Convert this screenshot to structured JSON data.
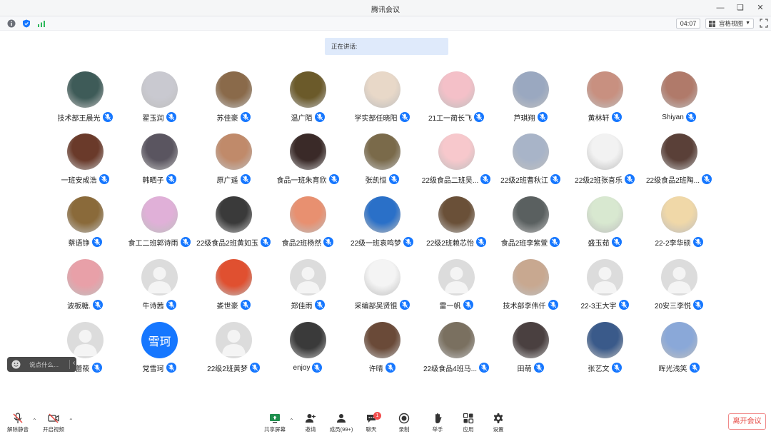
{
  "window": {
    "title": "腾讯会议"
  },
  "topbar": {
    "timer": "04:07",
    "view_label": "宫格视图"
  },
  "speaking": {
    "label": "正在讲话:"
  },
  "participants": [
    {
      "name": "技术部王晨光",
      "avatar": "photo",
      "color": "#3e5b58"
    },
    {
      "name": "翟玉润",
      "avatar": "photo",
      "color": "#c9c9d0"
    },
    {
      "name": "苏佳豪",
      "avatar": "photo",
      "color": "#8a6a4a"
    },
    {
      "name": "温广陌",
      "avatar": "photo",
      "color": "#6b5a2a"
    },
    {
      "name": "学实部任晓阳",
      "avatar": "photo",
      "color": "#e8d8c8"
    },
    {
      "name": "21工一蔺长飞",
      "avatar": "photo",
      "color": "#f4c0c8"
    },
    {
      "name": "芦琪翔",
      "avatar": "photo",
      "color": "#9aa8c0"
    },
    {
      "name": "黄林轩",
      "avatar": "photo",
      "color": "#c89080"
    },
    {
      "name": "Shiyan",
      "avatar": "photo",
      "color": "#b07a6a"
    },
    {
      "name": "一班安成浩",
      "avatar": "photo",
      "color": "#6a3a2a"
    },
    {
      "name": "韩晒子",
      "avatar": "photo",
      "color": "#5a5560"
    },
    {
      "name": "原广遥",
      "avatar": "photo",
      "color": "#c08a6a"
    },
    {
      "name": "食品一班朱育欣",
      "avatar": "photo",
      "color": "#3a2a28"
    },
    {
      "name": "张凯恒",
      "avatar": "photo",
      "color": "#7a6a4a"
    },
    {
      "name": "22级食品二班吴...",
      "avatar": "photo",
      "color": "#f7c8cc"
    },
    {
      "name": "22级2班曹秋江",
      "avatar": "photo",
      "color": "#a8b4c8"
    },
    {
      "name": "22级2班张喜乐",
      "avatar": "photo",
      "color": "#f2f2f2"
    },
    {
      "name": "22级食品2班陶...",
      "avatar": "photo",
      "color": "#5a4038"
    },
    {
      "name": "蔡语铮",
      "avatar": "photo",
      "color": "#8a6a3a"
    },
    {
      "name": "食工二班郭诗雨",
      "avatar": "photo",
      "color": "#e0b0d8"
    },
    {
      "name": "22级食品2班黄如玉",
      "avatar": "photo",
      "color": "#3a3a3a"
    },
    {
      "name": "食品2班杨然",
      "avatar": "photo",
      "color": "#e89070"
    },
    {
      "name": "22级一班袁鸣梦",
      "avatar": "photo",
      "color": "#2a70c8"
    },
    {
      "name": "22级2班赖芯怡",
      "avatar": "photo",
      "color": "#6a5038"
    },
    {
      "name": "食品2班李紫萱",
      "avatar": "photo",
      "color": "#5a6060"
    },
    {
      "name": "盛玉茹",
      "avatar": "photo",
      "color": "#d8e8d0"
    },
    {
      "name": "22-2李华硕",
      "avatar": "photo",
      "color": "#f0d8a8"
    },
    {
      "name": "波板糖.",
      "avatar": "photo",
      "color": "#e8a0a8"
    },
    {
      "name": "牛诗茜",
      "avatar": "default",
      "color": "#dcdcdc"
    },
    {
      "name": "娄世豪",
      "avatar": "photo",
      "color": "#e05030"
    },
    {
      "name": "郑佳雨",
      "avatar": "default",
      "color": "#dcdcdc"
    },
    {
      "name": "采编部吴贤锟",
      "avatar": "photo",
      "color": "#f4f4f4"
    },
    {
      "name": "雷一帆",
      "avatar": "default",
      "color": "#dcdcdc"
    },
    {
      "name": "技术部李伟仟",
      "avatar": "photo",
      "color": "#c8a890"
    },
    {
      "name": "22-3王大宇",
      "avatar": "default",
      "color": "#dcdcdc"
    },
    {
      "name": "20安三李悦",
      "avatar": "default",
      "color": "#dcdcdc"
    },
    {
      "name": "王蕾筱",
      "avatar": "default",
      "color": "#dcdcdc"
    },
    {
      "name": "党雪珂",
      "avatar": "text",
      "text": "雪珂",
      "color": "#1677ff"
    },
    {
      "name": "22级2班黄梦",
      "avatar": "default",
      "color": "#dcdcdc"
    },
    {
      "name": "enjoy",
      "avatar": "photo",
      "color": "#3a3a3a"
    },
    {
      "name": "许晴",
      "avatar": "photo",
      "color": "#6a4a38"
    },
    {
      "name": "22级食品4班马...",
      "avatar": "photo",
      "color": "#7a7060"
    },
    {
      "name": "田萌",
      "avatar": "photo",
      "color": "#4a4040"
    },
    {
      "name": "张艺文",
      "avatar": "photo",
      "color": "#3a5a8a"
    },
    {
      "name": "晖光浅笑",
      "avatar": "photo",
      "color": "#8aa8d8"
    }
  ],
  "chat": {
    "placeholder": "说点什么..."
  },
  "controls": {
    "unmute": "解除静音",
    "start_video": "开启视频",
    "share_screen": "共享屏幕",
    "invite": "邀请",
    "members": "成员(99+)",
    "chat": "聊天",
    "chat_badge": "1",
    "record": "录制",
    "raise_hand": "举手",
    "apps": "应用",
    "settings": "设置",
    "leave": "离开会议"
  },
  "colors": {
    "accent": "#1677ff",
    "leave_red": "#e5453f",
    "speaking_bg": "#dfeafb"
  }
}
